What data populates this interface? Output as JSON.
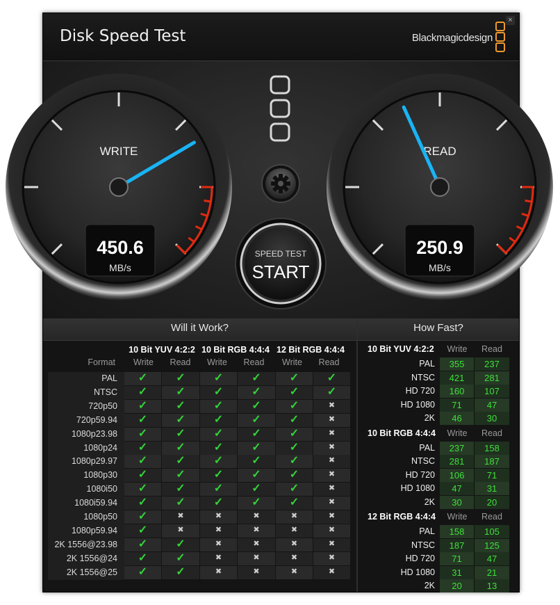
{
  "window": {
    "title": "Disk Speed Test",
    "brand": "Blackmagicdesign",
    "close_label": "×"
  },
  "gauges": {
    "write": {
      "label": "WRITE",
      "value": "450.6",
      "unit": "MB/s",
      "needle_fraction": 0.72
    },
    "read": {
      "label": "READ",
      "value": "250.9",
      "unit": "MB/s",
      "needle_fraction": 0.41
    }
  },
  "start_button": {
    "top": "SPEED TEST",
    "main": "START"
  },
  "will_it_work": {
    "title": "Will it Work?",
    "format_header": "Format",
    "groups": [
      "10 Bit YUV 4:2:2",
      "10 Bit RGB 4:4:4",
      "12 Bit RGB 4:4:4"
    ],
    "sub": [
      "Write",
      "Read"
    ],
    "rows": [
      {
        "format": "PAL",
        "ok": [
          1,
          1,
          1,
          1,
          1,
          1
        ]
      },
      {
        "format": "NTSC",
        "ok": [
          1,
          1,
          1,
          1,
          1,
          1
        ]
      },
      {
        "format": "720p50",
        "ok": [
          1,
          1,
          1,
          1,
          1,
          0
        ]
      },
      {
        "format": "720p59.94",
        "ok": [
          1,
          1,
          1,
          1,
          1,
          0
        ]
      },
      {
        "format": "1080p23.98",
        "ok": [
          1,
          1,
          1,
          1,
          1,
          0
        ]
      },
      {
        "format": "1080p24",
        "ok": [
          1,
          1,
          1,
          1,
          1,
          0
        ]
      },
      {
        "format": "1080p29.97",
        "ok": [
          1,
          1,
          1,
          1,
          1,
          0
        ]
      },
      {
        "format": "1080p30",
        "ok": [
          1,
          1,
          1,
          1,
          1,
          0
        ]
      },
      {
        "format": "1080i50",
        "ok": [
          1,
          1,
          1,
          1,
          1,
          0
        ]
      },
      {
        "format": "1080i59.94",
        "ok": [
          1,
          1,
          1,
          1,
          1,
          0
        ]
      },
      {
        "format": "1080p50",
        "ok": [
          1,
          0,
          0,
          0,
          0,
          0
        ]
      },
      {
        "format": "1080p59.94",
        "ok": [
          1,
          0,
          0,
          0,
          0,
          0
        ]
      },
      {
        "format": "2K 1556@23.98",
        "ok": [
          1,
          1,
          0,
          0,
          0,
          0
        ]
      },
      {
        "format": "2K 1556@24",
        "ok": [
          1,
          1,
          0,
          0,
          0,
          0
        ]
      },
      {
        "format": "2K 1556@25",
        "ok": [
          1,
          1,
          0,
          0,
          0,
          0
        ]
      }
    ]
  },
  "how_fast": {
    "title": "How Fast?",
    "sub": [
      "Write",
      "Read"
    ],
    "groups": [
      {
        "name": "10 Bit YUV 4:2:2",
        "rows": [
          {
            "label": "PAL",
            "write": "355",
            "read": "237"
          },
          {
            "label": "NTSC",
            "write": "421",
            "read": "281"
          },
          {
            "label": "HD 720",
            "write": "160",
            "read": "107"
          },
          {
            "label": "HD 1080",
            "write": "71",
            "read": "47"
          },
          {
            "label": "2K",
            "write": "46",
            "read": "30"
          }
        ]
      },
      {
        "name": "10 Bit RGB 4:4:4",
        "rows": [
          {
            "label": "PAL",
            "write": "237",
            "read": "158"
          },
          {
            "label": "NTSC",
            "write": "281",
            "read": "187"
          },
          {
            "label": "HD 720",
            "write": "106",
            "read": "71"
          },
          {
            "label": "HD 1080",
            "write": "47",
            "read": "31"
          },
          {
            "label": "2K",
            "write": "30",
            "read": "20"
          }
        ]
      },
      {
        "name": "12 Bit RGB 4:4:4",
        "rows": [
          {
            "label": "PAL",
            "write": "158",
            "read": "105"
          },
          {
            "label": "NTSC",
            "write": "187",
            "read": "125"
          },
          {
            "label": "HD 720",
            "write": "71",
            "read": "47"
          },
          {
            "label": "HD 1080",
            "write": "31",
            "read": "21"
          },
          {
            "label": "2K",
            "write": "20",
            "read": "13"
          }
        ]
      }
    ]
  },
  "colors": {
    "accent_needle": "#19b4f5",
    "ok": "#35d339",
    "value_green": "#3fe03a",
    "redline": "#e02a10",
    "brand_orange": "#f09a2e"
  }
}
